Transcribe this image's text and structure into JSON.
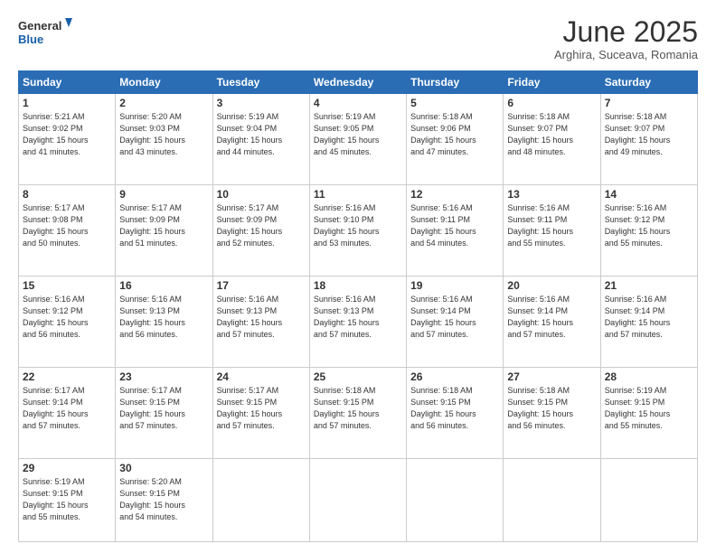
{
  "logo": {
    "line1": "General",
    "line2": "Blue"
  },
  "title": "June 2025",
  "location": "Arghira, Suceava, Romania",
  "days_of_week": [
    "Sunday",
    "Monday",
    "Tuesday",
    "Wednesday",
    "Thursday",
    "Friday",
    "Saturday"
  ],
  "weeks": [
    [
      {
        "day": "1",
        "info": "Sunrise: 5:21 AM\nSunset: 9:02 PM\nDaylight: 15 hours\nand 41 minutes."
      },
      {
        "day": "2",
        "info": "Sunrise: 5:20 AM\nSunset: 9:03 PM\nDaylight: 15 hours\nand 43 minutes."
      },
      {
        "day": "3",
        "info": "Sunrise: 5:19 AM\nSunset: 9:04 PM\nDaylight: 15 hours\nand 44 minutes."
      },
      {
        "day": "4",
        "info": "Sunrise: 5:19 AM\nSunset: 9:05 PM\nDaylight: 15 hours\nand 45 minutes."
      },
      {
        "day": "5",
        "info": "Sunrise: 5:18 AM\nSunset: 9:06 PM\nDaylight: 15 hours\nand 47 minutes."
      },
      {
        "day": "6",
        "info": "Sunrise: 5:18 AM\nSunset: 9:07 PM\nDaylight: 15 hours\nand 48 minutes."
      },
      {
        "day": "7",
        "info": "Sunrise: 5:18 AM\nSunset: 9:07 PM\nDaylight: 15 hours\nand 49 minutes."
      }
    ],
    [
      {
        "day": "8",
        "info": "Sunrise: 5:17 AM\nSunset: 9:08 PM\nDaylight: 15 hours\nand 50 minutes."
      },
      {
        "day": "9",
        "info": "Sunrise: 5:17 AM\nSunset: 9:09 PM\nDaylight: 15 hours\nand 51 minutes."
      },
      {
        "day": "10",
        "info": "Sunrise: 5:17 AM\nSunset: 9:09 PM\nDaylight: 15 hours\nand 52 minutes."
      },
      {
        "day": "11",
        "info": "Sunrise: 5:16 AM\nSunset: 9:10 PM\nDaylight: 15 hours\nand 53 minutes."
      },
      {
        "day": "12",
        "info": "Sunrise: 5:16 AM\nSunset: 9:11 PM\nDaylight: 15 hours\nand 54 minutes."
      },
      {
        "day": "13",
        "info": "Sunrise: 5:16 AM\nSunset: 9:11 PM\nDaylight: 15 hours\nand 55 minutes."
      },
      {
        "day": "14",
        "info": "Sunrise: 5:16 AM\nSunset: 9:12 PM\nDaylight: 15 hours\nand 55 minutes."
      }
    ],
    [
      {
        "day": "15",
        "info": "Sunrise: 5:16 AM\nSunset: 9:12 PM\nDaylight: 15 hours\nand 56 minutes."
      },
      {
        "day": "16",
        "info": "Sunrise: 5:16 AM\nSunset: 9:13 PM\nDaylight: 15 hours\nand 56 minutes."
      },
      {
        "day": "17",
        "info": "Sunrise: 5:16 AM\nSunset: 9:13 PM\nDaylight: 15 hours\nand 57 minutes."
      },
      {
        "day": "18",
        "info": "Sunrise: 5:16 AM\nSunset: 9:13 PM\nDaylight: 15 hours\nand 57 minutes."
      },
      {
        "day": "19",
        "info": "Sunrise: 5:16 AM\nSunset: 9:14 PM\nDaylight: 15 hours\nand 57 minutes."
      },
      {
        "day": "20",
        "info": "Sunrise: 5:16 AM\nSunset: 9:14 PM\nDaylight: 15 hours\nand 57 minutes."
      },
      {
        "day": "21",
        "info": "Sunrise: 5:16 AM\nSunset: 9:14 PM\nDaylight: 15 hours\nand 57 minutes."
      }
    ],
    [
      {
        "day": "22",
        "info": "Sunrise: 5:17 AM\nSunset: 9:14 PM\nDaylight: 15 hours\nand 57 minutes."
      },
      {
        "day": "23",
        "info": "Sunrise: 5:17 AM\nSunset: 9:15 PM\nDaylight: 15 hours\nand 57 minutes."
      },
      {
        "day": "24",
        "info": "Sunrise: 5:17 AM\nSunset: 9:15 PM\nDaylight: 15 hours\nand 57 minutes."
      },
      {
        "day": "25",
        "info": "Sunrise: 5:18 AM\nSunset: 9:15 PM\nDaylight: 15 hours\nand 57 minutes."
      },
      {
        "day": "26",
        "info": "Sunrise: 5:18 AM\nSunset: 9:15 PM\nDaylight: 15 hours\nand 56 minutes."
      },
      {
        "day": "27",
        "info": "Sunrise: 5:18 AM\nSunset: 9:15 PM\nDaylight: 15 hours\nand 56 minutes."
      },
      {
        "day": "28",
        "info": "Sunrise: 5:19 AM\nSunset: 9:15 PM\nDaylight: 15 hours\nand 55 minutes."
      }
    ],
    [
      {
        "day": "29",
        "info": "Sunrise: 5:19 AM\nSunset: 9:15 PM\nDaylight: 15 hours\nand 55 minutes."
      },
      {
        "day": "30",
        "info": "Sunrise: 5:20 AM\nSunset: 9:15 PM\nDaylight: 15 hours\nand 54 minutes."
      },
      {
        "day": "",
        "info": ""
      },
      {
        "day": "",
        "info": ""
      },
      {
        "day": "",
        "info": ""
      },
      {
        "day": "",
        "info": ""
      },
      {
        "day": "",
        "info": ""
      }
    ]
  ]
}
